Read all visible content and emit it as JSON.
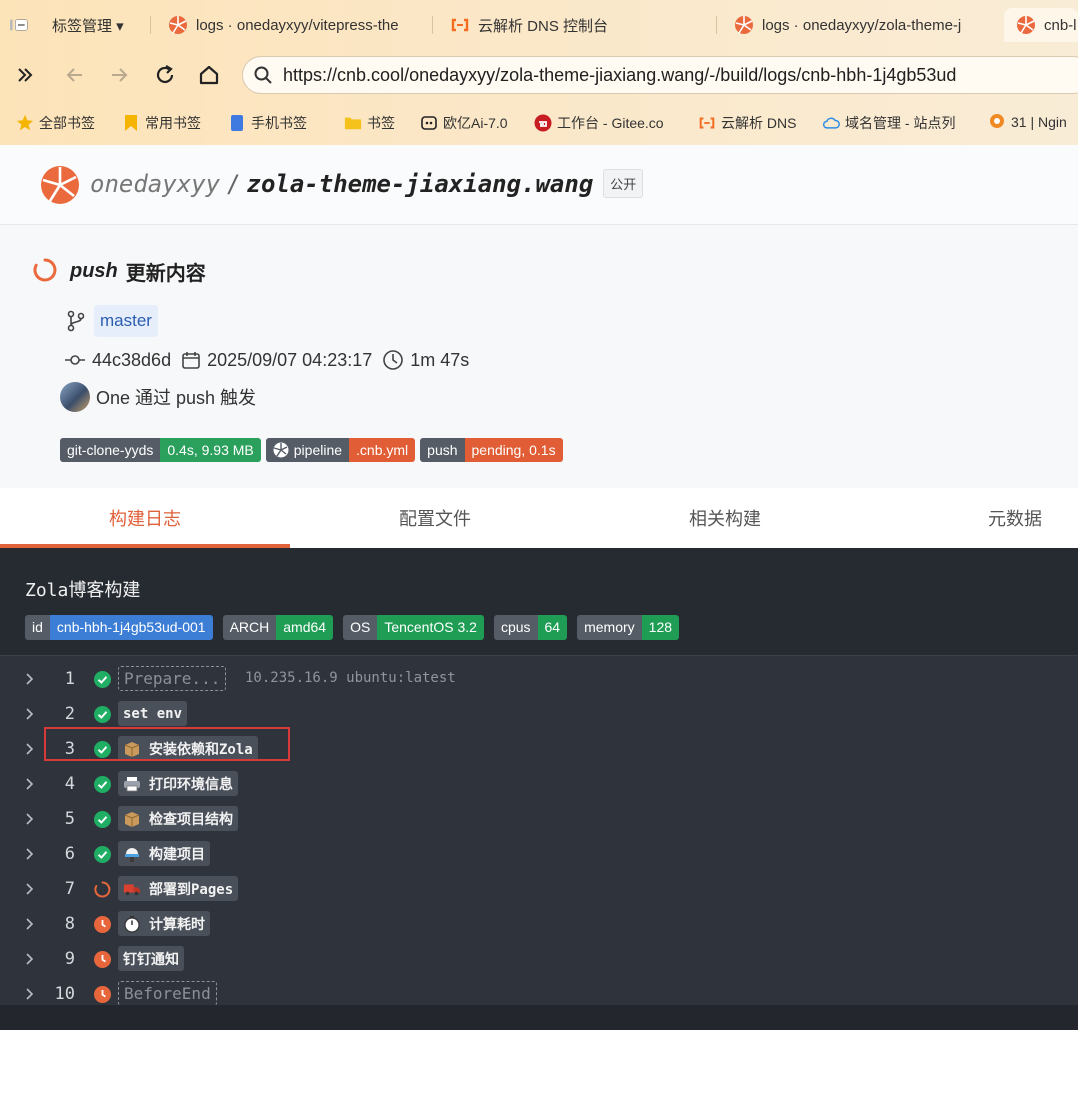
{
  "browser": {
    "tabs": [
      {
        "label": "标签管理 ▾"
      },
      {
        "label": "logs · onedayxyy/vitepress-the"
      },
      {
        "label": "云解析 DNS 控制台"
      },
      {
        "label": "logs · onedayxyy/zola-theme-j"
      },
      {
        "label": "cnb-l"
      }
    ],
    "url": "https://cnb.cool/onedayxyy/zola-theme-jiaxiang.wang/-/build/logs/cnb-hbh-1j4gb53ud",
    "bookmarks": [
      {
        "label": "全部书签",
        "icon": "star-icon"
      },
      {
        "label": "常用书签",
        "icon": "bookmark-icon"
      },
      {
        "label": "手机书签",
        "icon": "phone-icon"
      },
      {
        "label": "书签",
        "icon": "folder-icon"
      },
      {
        "label": "欧亿Ai-7.0",
        "icon": "bot-icon"
      },
      {
        "label": "工作台 - Gitee.co",
        "icon": "gitee-icon"
      },
      {
        "label": "云解析 DNS",
        "icon": "aliyun-icon"
      },
      {
        "label": "域名管理 - 站点列",
        "icon": "cloud-icon"
      },
      {
        "label": "31 | Ngin",
        "icon": "geek-icon"
      }
    ]
  },
  "repo": {
    "owner": "onedayxyy",
    "separator": "/",
    "name": "zola-theme-jiaxiang.wang",
    "visibility": "公开"
  },
  "build": {
    "event": "push",
    "title": "更新内容",
    "branch": "master",
    "commit": "44c38d6d",
    "datetime": "2025/09/07 04:23:17",
    "duration": "1m 47s",
    "trigger": "One 通过 push 触发",
    "badges": [
      {
        "left": "git-clone-yyds",
        "right": "0.4s, 9.93 MB",
        "color": "#2aa05c"
      },
      {
        "left": "pipeline",
        "right": ".cnb.yml",
        "color": "#e05d35"
      },
      {
        "left": "push",
        "right": "pending, 0.1s",
        "color": "#e05d35"
      }
    ]
  },
  "page_tabs": [
    {
      "label": "构建日志",
      "active": true
    },
    {
      "label": "配置文件",
      "active": false
    },
    {
      "label": "相关构建",
      "active": false
    },
    {
      "label": "元数据",
      "active": false
    }
  ],
  "logs": {
    "title_mono": "Zola",
    "title_rest": "博客构建",
    "env": [
      {
        "key": "id",
        "value": "cnb-hbh-1j4gb53ud-001",
        "color": "#3c7ed6"
      },
      {
        "key": "ARCH",
        "value": "amd64",
        "color": "#1f9d55"
      },
      {
        "key": "OS",
        "value": "TencentOS 3.2",
        "color": "#1f9d55"
      },
      {
        "key": "cpus",
        "value": "64",
        "color": "#1f9d55"
      },
      {
        "key": "memory",
        "value": "128",
        "color": "#1f9d55"
      }
    ],
    "steps": [
      {
        "num": "1",
        "status": "success",
        "label": "Prepare...",
        "style": "dashed",
        "extra": "10.235.16.9 ubuntu:latest"
      },
      {
        "num": "2",
        "status": "success",
        "label": "set env",
        "style": "solid"
      },
      {
        "num": "3",
        "status": "success",
        "label": "安装依赖和Zola",
        "style": "solid",
        "emoji": "package-icon"
      },
      {
        "num": "4",
        "status": "success",
        "label": "打印环境信息",
        "style": "solid",
        "emoji": "printer-icon"
      },
      {
        "num": "5",
        "status": "success",
        "label": "检查项目结构",
        "style": "solid",
        "emoji": "package-icon"
      },
      {
        "num": "6",
        "status": "success",
        "label": "构建项目",
        "style": "solid",
        "emoji": "construction-icon"
      },
      {
        "num": "7",
        "status": "running",
        "label": "部署到Pages",
        "style": "solid",
        "emoji": "truck-icon"
      },
      {
        "num": "8",
        "status": "pending",
        "label": "计算耗时",
        "style": "solid",
        "emoji": "stopwatch-icon"
      },
      {
        "num": "9",
        "status": "pending",
        "label": "钉钉通知",
        "style": "solid"
      },
      {
        "num": "10",
        "status": "pending",
        "label": "BeforeEnd",
        "style": "dashed"
      }
    ]
  },
  "colors": {
    "accent": "#e0623a",
    "success": "#1fae63",
    "pending": "#e8663c",
    "highlight": "#d83a3a"
  }
}
